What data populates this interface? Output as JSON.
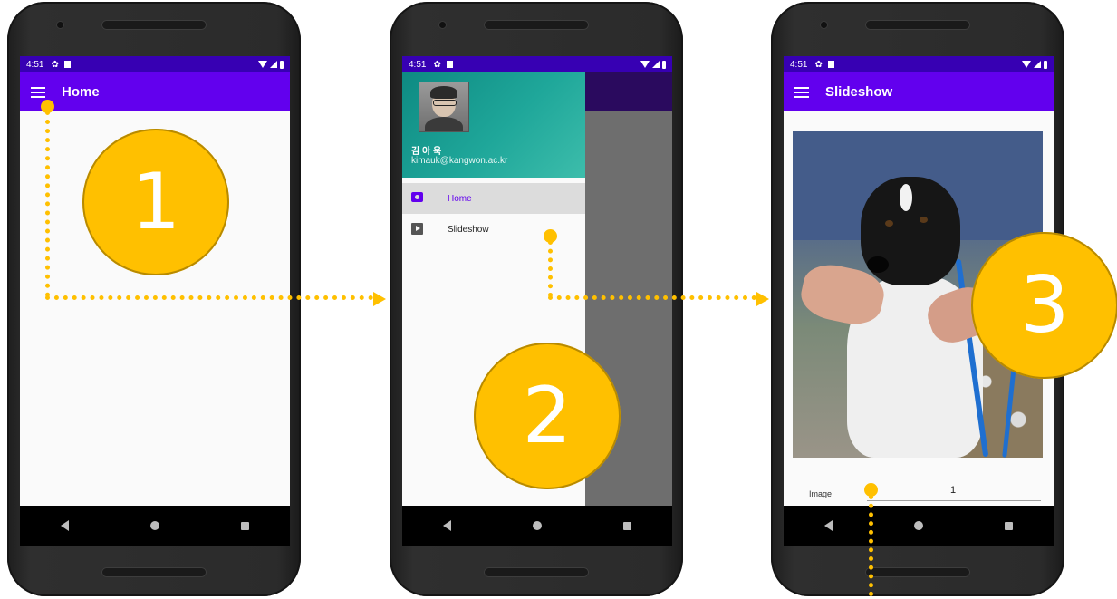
{
  "phones": [
    {
      "status_time": "4:51",
      "app_title": "Home"
    },
    {
      "status_time": "4:51",
      "drawer": {
        "user_name": "김 아 욱",
        "user_email": "kimauk@kangwon.ac.kr",
        "items": [
          {
            "label": "Home",
            "icon": "camera-icon",
            "active": true
          },
          {
            "label": "Slideshow",
            "icon": "slideshow-icon",
            "active": false
          }
        ]
      }
    },
    {
      "status_time": "4:51",
      "app_title": "Slideshow",
      "image_field": {
        "label": "Image",
        "value": "1"
      }
    }
  ],
  "annotations": {
    "step1": "1",
    "step2": "2",
    "step3": "3"
  },
  "colors": {
    "status_bar": "#3700b3",
    "app_bar": "#6200ee",
    "drawer_header": "#1fa79a",
    "annotation": "#ffc000"
  }
}
